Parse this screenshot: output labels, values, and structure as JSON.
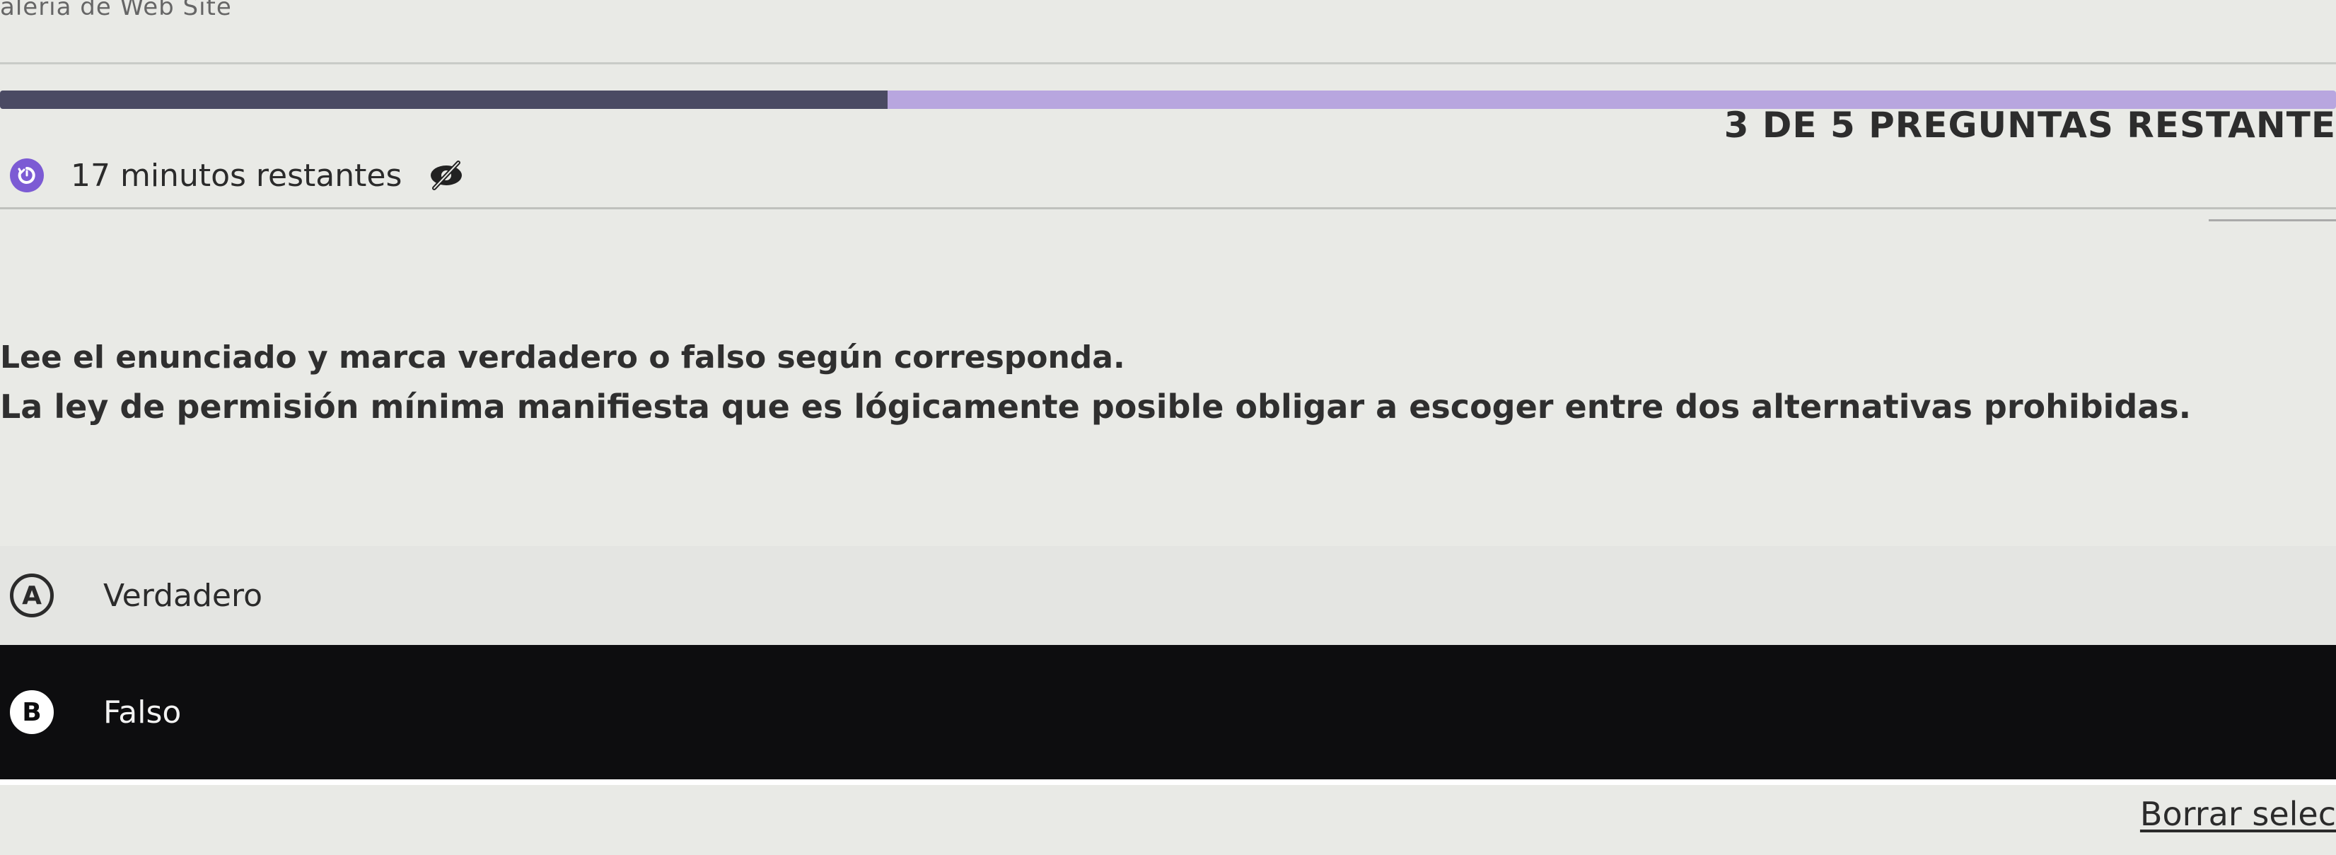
{
  "tab": {
    "title": "alería de Web Site"
  },
  "progress": {
    "value": 0.38
  },
  "header": {
    "timer_text": "17 minutos restantes",
    "timer_icon": "stopwatch-icon",
    "hide_icon": "eye-slash-icon",
    "counter": "3 DE 5 PREGUNTAS RESTANTE"
  },
  "question": {
    "instruction": "Lee el enunciado y marca verdadero o falso según corresponda.",
    "statement": "La ley de permisión mínima manifiesta que es lógicamente posible obligar a escoger entre dos alternativas prohibidas."
  },
  "options": [
    {
      "letter": "A",
      "label": "Verdadero"
    },
    {
      "letter": "B",
      "label": "Falso"
    }
  ],
  "actions": {
    "clear_label": "Borrar selec"
  },
  "colors": {
    "accent": "#7c5bd4",
    "progress_track": "#b8a6df",
    "progress_fill": "#4a4a63",
    "selected_bg": "#0d0d0f"
  }
}
